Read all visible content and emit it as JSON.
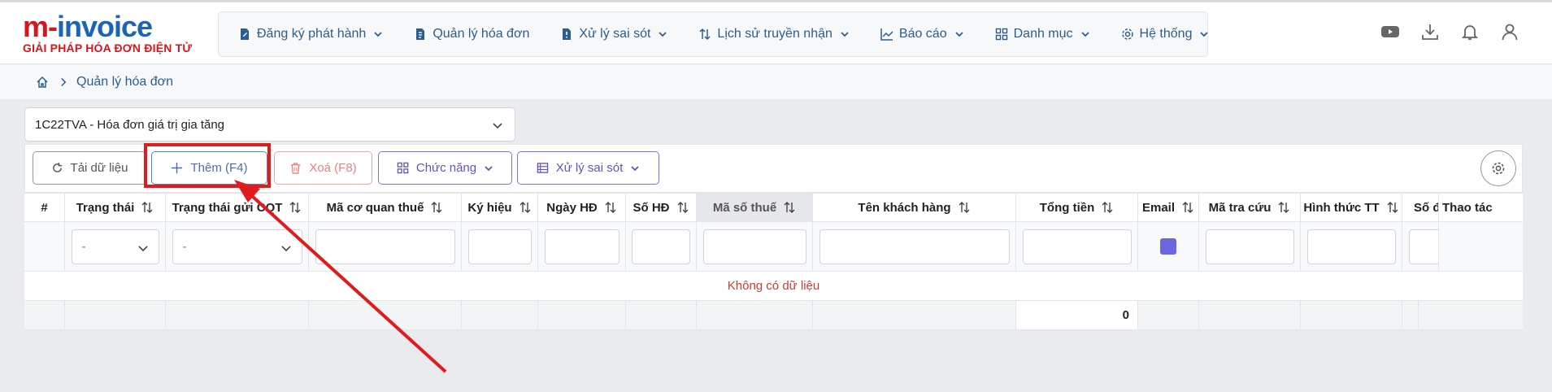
{
  "logo": {
    "brand_m": "m",
    "brand_dash": "-",
    "brand_rest": "invoice",
    "tagline": "GIẢI PHÁP HÓA ĐƠN ĐIỆN TỬ"
  },
  "nav": {
    "items": [
      {
        "label": "Đăng ký phát hành",
        "icon": "document-edit-icon",
        "has_dropdown": true
      },
      {
        "label": "Quản lý hóa đơn",
        "icon": "invoice-icon",
        "has_dropdown": false
      },
      {
        "label": "Xử lý sai sót",
        "icon": "document-warning-icon",
        "has_dropdown": true
      },
      {
        "label": "Lịch sử truyền nhận",
        "icon": "transfer-icon",
        "has_dropdown": true
      },
      {
        "label": "Báo cáo",
        "icon": "chart-line-icon",
        "has_dropdown": true
      },
      {
        "label": "Danh mục",
        "icon": "grid-icon",
        "has_dropdown": true
      },
      {
        "label": "Hệ thống",
        "icon": "gear-icon",
        "has_dropdown": true
      }
    ]
  },
  "header_icons": [
    "youtube-icon",
    "download-icon",
    "bell-icon",
    "user-icon"
  ],
  "breadcrumb": {
    "home_icon": "home-icon",
    "current": "Quản lý hóa đơn"
  },
  "series_select": {
    "value": "1C22TVA - Hóa đơn giá trị gia tăng"
  },
  "toolbar": {
    "reload_label": "Tải dữ liệu",
    "add_label": "Thêm (F4)",
    "delete_label": "Xoá (F8)",
    "functions_label": "Chức năng",
    "fix_errors_label": "Xử lý sai sót"
  },
  "table": {
    "columns": [
      {
        "label": "#"
      },
      {
        "label": "Trạng thái"
      },
      {
        "label": "Trạng thái gửi CQT"
      },
      {
        "label": "Mã cơ quan thuế"
      },
      {
        "label": "Ký hiệu"
      },
      {
        "label": "Ngày HĐ"
      },
      {
        "label": "Số HĐ"
      },
      {
        "label": "Mã số thuế"
      },
      {
        "label": "Tên khách hàng"
      },
      {
        "label": "Tổng tiền"
      },
      {
        "label": "Email"
      },
      {
        "label": "Mã tra cứu"
      },
      {
        "label": "Hình thức TT"
      },
      {
        "label": "Số đ"
      },
      {
        "label": "Thao tác"
      }
    ],
    "filter_status_value": "-",
    "filter_cqt_value": "-",
    "empty_message": "Không có dữ liệu",
    "total_amount": "0"
  },
  "colors": {
    "brand_red": "#d7161b",
    "brand_blue": "#1b65b8",
    "nav_text": "#2b5d8f",
    "annotation_red": "#e11a1a",
    "empty_text": "#d13a32"
  }
}
